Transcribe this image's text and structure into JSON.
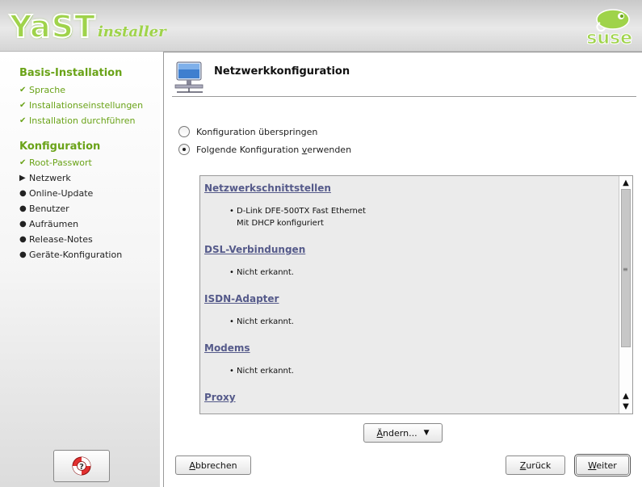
{
  "header": {
    "logo_main": "YaST",
    "logo_sub": "installer",
    "vendor": "suse"
  },
  "sidebar": {
    "sections": [
      {
        "title": "Basis-Installation",
        "steps": [
          {
            "label": "Sprache",
            "state": "done"
          },
          {
            "label": "Installationseinstellungen",
            "state": "done"
          },
          {
            "label": "Installation durchführen",
            "state": "done"
          }
        ]
      },
      {
        "title": "Konfiguration",
        "steps": [
          {
            "label": "Root-Passwort",
            "state": "done"
          },
          {
            "label": "Netzwerk",
            "state": "current"
          },
          {
            "label": "Online-Update",
            "state": "todo"
          },
          {
            "label": "Benutzer",
            "state": "todo"
          },
          {
            "label": "Aufräumen",
            "state": "todo"
          },
          {
            "label": "Release-Notes",
            "state": "todo"
          },
          {
            "label": "Geräte-Konfiguration",
            "state": "todo"
          }
        ]
      }
    ],
    "help_icon": "help-lifebuoy-icon"
  },
  "main": {
    "title": "Netzwerkkonfiguration",
    "title_icon": "network-computer-icon",
    "radios": [
      {
        "label_pre": "Konfiguration überspringen",
        "label_key": "",
        "label_post": "",
        "checked": false
      },
      {
        "label_pre": "Folgende Konfiguration ",
        "label_key": "v",
        "label_post": "erwenden",
        "checked": true
      }
    ],
    "richtext": {
      "sections": [
        {
          "heading": "Netzwerkschnittstellen",
          "items": [
            {
              "text": "D-Link DFE-500TX Fast Ethernet",
              "sub": "Mit DHCP konfiguriert"
            }
          ]
        },
        {
          "heading": "DSL-Verbindungen",
          "items": [
            {
              "text": "Nicht erkannt.",
              "sub": ""
            }
          ]
        },
        {
          "heading": "ISDN-Adapter",
          "items": [
            {
              "text": "Nicht erkannt.",
              "sub": ""
            }
          ]
        },
        {
          "heading": "Modems",
          "items": [
            {
              "text": "Nicht erkannt.",
              "sub": ""
            }
          ]
        },
        {
          "heading": "Proxy",
          "items": []
        }
      ]
    },
    "buttons": {
      "change_key": "Ä",
      "change_rest": "ndern...",
      "abort_key": "A",
      "abort_rest": "bbrechen",
      "back_key": "Z",
      "back_rest": "urück",
      "next_key": "W",
      "next_rest": "eiter"
    }
  },
  "colors": {
    "accent_green": "#6aa318",
    "link_heading": "#555a8a"
  }
}
